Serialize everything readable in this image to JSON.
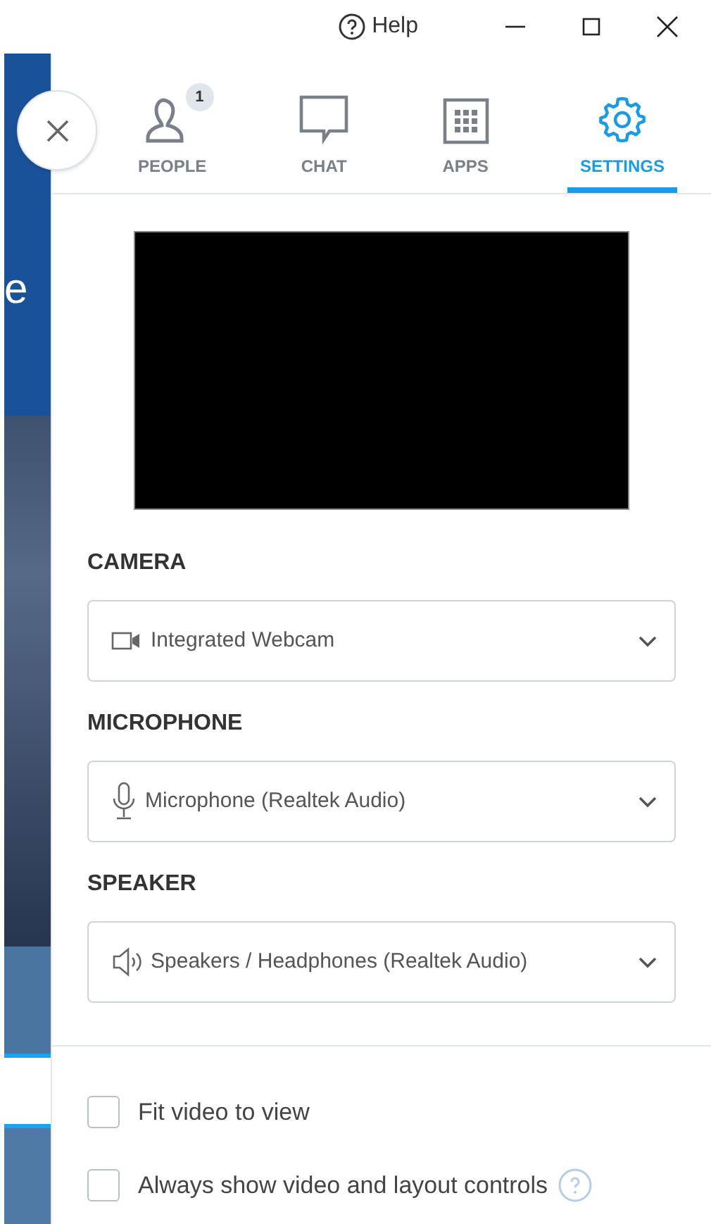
{
  "title_bar": {
    "help": "Help"
  },
  "background_app": {
    "text": "e"
  },
  "tabs": [
    {
      "kind": "people",
      "label": "PEOPLE",
      "badge": "1",
      "selected": false
    },
    {
      "kind": "chat",
      "label": "CHAT",
      "selected": false
    },
    {
      "kind": "apps",
      "label": "APPS",
      "selected": false
    },
    {
      "kind": "settings",
      "label": "SETTINGS",
      "selected": true
    }
  ],
  "devices": [
    {
      "kind": "camera",
      "label": "CAMERA",
      "value": "Integrated Webcam"
    },
    {
      "kind": "microphone",
      "label": "MICROPHONE",
      "value": "Microphone (Realtek Audio)"
    },
    {
      "kind": "speaker",
      "label": "SPEAKER",
      "value": "Speakers / Headphones (Realtek Audio)"
    }
  ],
  "options": [
    {
      "label": "Fit video to view",
      "checked": false,
      "help": false
    },
    {
      "label": "Always show video and layout controls",
      "checked": false,
      "help": true
    }
  ]
}
